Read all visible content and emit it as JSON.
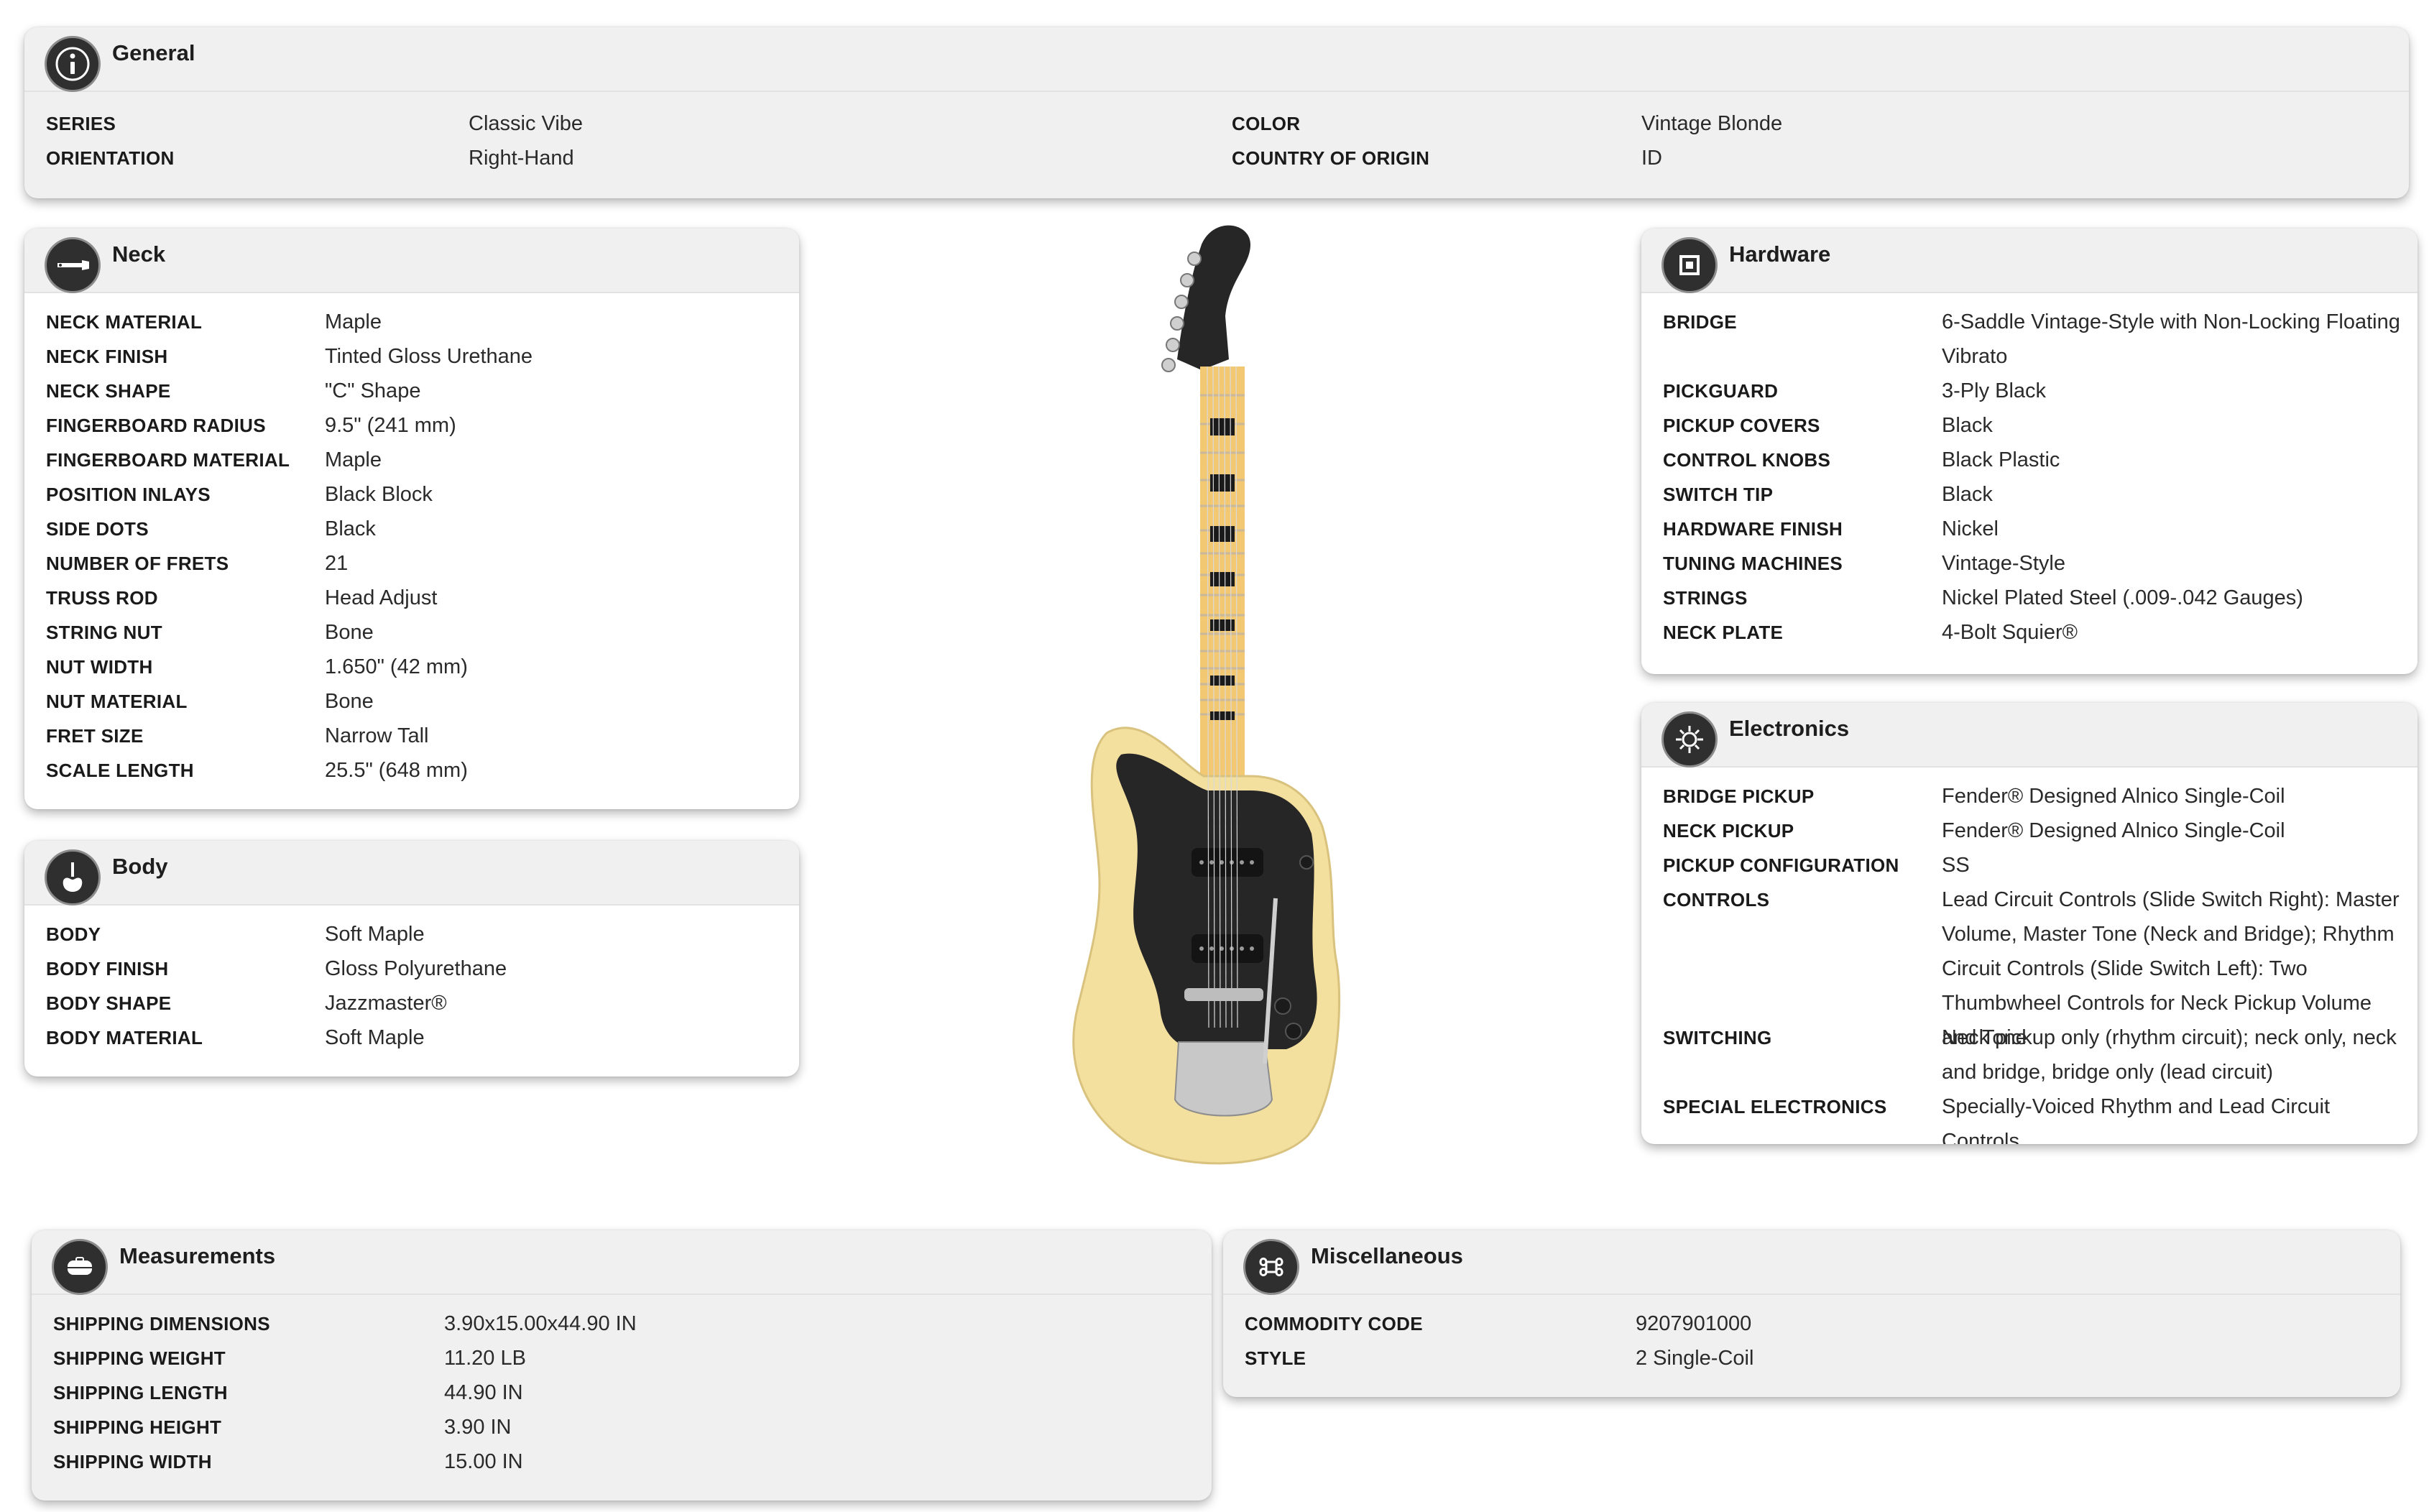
{
  "general": {
    "title": "General",
    "icon": "info-icon",
    "left_rows": [
      {
        "label": "SERIES",
        "value": "Classic Vibe"
      },
      {
        "label": "ORIENTATION",
        "value": "Right-Hand"
      }
    ],
    "right_rows": [
      {
        "label": "COLOR",
        "value": "Vintage Blonde"
      },
      {
        "label": "COUNTRY OF ORIGIN",
        "value": "ID"
      }
    ]
  },
  "neck": {
    "title": "Neck",
    "icon": "neck-icon",
    "rows": [
      {
        "label": "NECK MATERIAL",
        "value": "Maple"
      },
      {
        "label": "NECK FINISH",
        "value": "Tinted Gloss Urethane"
      },
      {
        "label": "NECK SHAPE",
        "value": "\"C\" Shape"
      },
      {
        "label": "FINGERBOARD RADIUS",
        "value": "9.5\" (241 mm)"
      },
      {
        "label": "FINGERBOARD MATERIAL",
        "value": "Maple"
      },
      {
        "label": "POSITION INLAYS",
        "value": "Black Block"
      },
      {
        "label": "SIDE DOTS",
        "value": "Black"
      },
      {
        "label": "NUMBER OF FRETS",
        "value": "21"
      },
      {
        "label": "TRUSS ROD",
        "value": "Head Adjust"
      },
      {
        "label": "STRING NUT",
        "value": "Bone"
      },
      {
        "label": "NUT WIDTH",
        "value": "1.650\" (42 mm)"
      },
      {
        "label": "NUT MATERIAL",
        "value": "Bone"
      },
      {
        "label": "FRET SIZE",
        "value": "Narrow Tall"
      },
      {
        "label": "SCALE LENGTH",
        "value": "25.5\" (648 mm)"
      }
    ]
  },
  "body": {
    "title": "Body",
    "icon": "guitar-body-icon",
    "rows": [
      {
        "label": "BODY",
        "value": "Soft Maple"
      },
      {
        "label": "BODY FINISH",
        "value": "Gloss Polyurethane"
      },
      {
        "label": "BODY SHAPE",
        "value": "Jazzmaster®"
      },
      {
        "label": "BODY MATERIAL",
        "value": "Soft Maple"
      }
    ]
  },
  "hardware": {
    "title": "Hardware",
    "icon": "hardware-icon",
    "rows": [
      {
        "label": "BRIDGE",
        "value": "6-Saddle Vintage-Style with Non-Locking Floating Vibrato"
      },
      {
        "label": "PICKGUARD",
        "value": "3-Ply Black"
      },
      {
        "label": "PICKUP COVERS",
        "value": "Black"
      },
      {
        "label": "CONTROL KNOBS",
        "value": "Black Plastic"
      },
      {
        "label": "SWITCH TIP",
        "value": "Black"
      },
      {
        "label": "HARDWARE FINISH",
        "value": "Nickel"
      },
      {
        "label": "TUNING MACHINES",
        "value": "Vintage-Style"
      },
      {
        "label": "STRINGS",
        "value": "Nickel Plated Steel (.009-.042 Gauges)"
      },
      {
        "label": "NECK PLATE",
        "value": "4-Bolt Squier®"
      }
    ]
  },
  "electronics": {
    "title": "Electronics",
    "icon": "electronics-icon",
    "rows": [
      {
        "label": "BRIDGE PICKUP",
        "value": "Fender® Designed Alnico Single-Coil"
      },
      {
        "label": "NECK PICKUP",
        "value": "Fender® Designed Alnico Single-Coil"
      },
      {
        "label": "PICKUP CONFIGURATION",
        "value": "SS"
      },
      {
        "label": "CONTROLS",
        "value": "Lead Circuit Controls (Slide Switch Right): Master Volume, Master Tone (Neck and Bridge); Rhythm Circuit Controls (Slide Switch Left): Two Thumbwheel Controls for Neck Pickup Volume and Tone"
      },
      {
        "label": "SWITCHING",
        "value": "Neck pickup only (rhythm circuit); neck only, neck and bridge, bridge only (lead circuit)"
      },
      {
        "label": "SPECIAL ELECTRONICS",
        "value": "Specially-Voiced Rhythm and Lead Circuit Controls"
      }
    ]
  },
  "measurements": {
    "title": "Measurements",
    "icon": "case-icon",
    "rows": [
      {
        "label": "SHIPPING DIMENSIONS",
        "value": "3.90x15.00x44.90 IN"
      },
      {
        "label": "SHIPPING WEIGHT",
        "value": "11.20 LB"
      },
      {
        "label": "SHIPPING LENGTH",
        "value": "44.90 IN"
      },
      {
        "label": "SHIPPING HEIGHT",
        "value": "3.90 IN"
      },
      {
        "label": "SHIPPING WIDTH",
        "value": "15.00 IN"
      }
    ]
  },
  "misc": {
    "title": "Miscellaneous",
    "icon": "command-icon",
    "rows": [
      {
        "label": "COMMODITY CODE",
        "value": "9207901000"
      },
      {
        "label": "STYLE",
        "value": "2 Single-Coil"
      }
    ]
  },
  "product_image": {
    "name": "guitar-image",
    "body_color": "#f3df9e",
    "pickguard_color": "#262626",
    "fretboard_color": "#f3c873"
  }
}
